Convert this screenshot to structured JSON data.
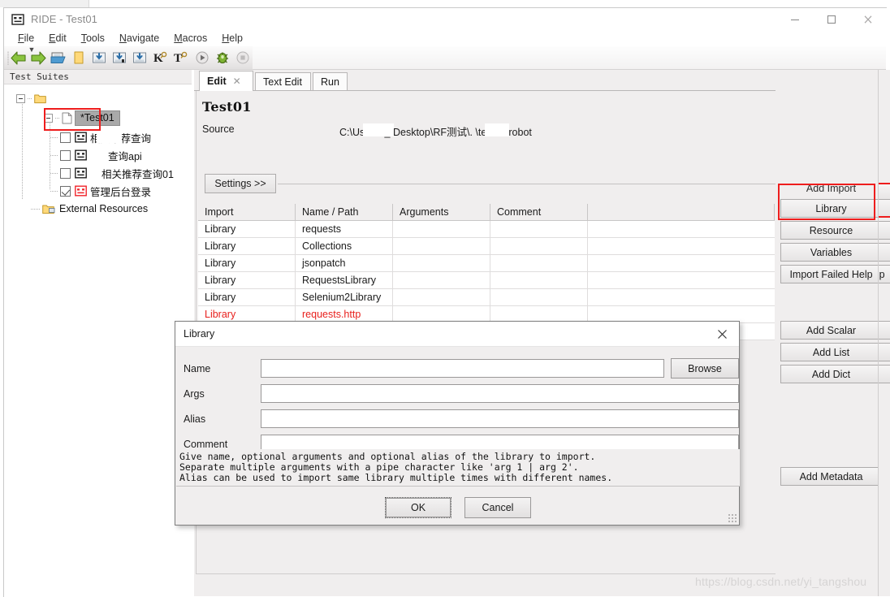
{
  "window": {
    "title": "RIDE - Test01",
    "icon": "robot-icon",
    "minimize": "—",
    "maximize": "□",
    "close": "✕"
  },
  "menubar": {
    "items": [
      {
        "label": "File",
        "accel": "F"
      },
      {
        "label": "Edit",
        "accel": "E"
      },
      {
        "label": "Tools",
        "accel": "T"
      },
      {
        "label": "Navigate",
        "accel": "N"
      },
      {
        "label": "Macros",
        "accel": "M"
      },
      {
        "label": "Help",
        "accel": "H"
      }
    ]
  },
  "toolbar": {
    "items": [
      {
        "name": "back-icon",
        "glyph": "←"
      },
      {
        "name": "forward-icon",
        "glyph": "→"
      },
      {
        "name": "open-folder-icon",
        "glyph": ""
      },
      {
        "name": "new-folder-icon",
        "glyph": ""
      },
      {
        "name": "save-icon",
        "glyph": ""
      },
      {
        "name": "save-as-icon",
        "glyph": ""
      },
      {
        "name": "save-all-icon",
        "glyph": ""
      },
      {
        "name": "search-keyword-icon",
        "glyph": "K"
      },
      {
        "name": "search-test-icon",
        "glyph": "T"
      },
      {
        "name": "run-icon",
        "glyph": "▶"
      },
      {
        "name": "debug-icon",
        "glyph": ""
      },
      {
        "name": "stop-icon",
        "glyph": "■"
      }
    ]
  },
  "sidebar": {
    "header": "Test Suites",
    "root_label": "",
    "selected_suite": "*Test01",
    "tests": [
      {
        "label": "相关推荐查询",
        "checked": false,
        "status": "normal",
        "masked": true
      },
      {
        "label": "查询api",
        "checked": false,
        "status": "normal",
        "masked": true
      },
      {
        "label": "相关推荐查询01",
        "checked": false,
        "status": "normal",
        "masked": true
      },
      {
        "label": "管理后台登录",
        "checked": true,
        "status": "error",
        "masked": false
      }
    ],
    "external_resources": "External Resources"
  },
  "editor": {
    "tabs": [
      {
        "label": "Edit",
        "active": true,
        "closable": true
      },
      {
        "label": "Text Edit",
        "active": false,
        "closable": false
      },
      {
        "label": "Run",
        "active": false,
        "closable": false
      }
    ],
    "title": "Test01",
    "source_label": "Source",
    "source_value": "C:\\Users\\        _\\Desktop\\RF测试\\.      \\test01.robot",
    "settings_button": "Settings  >>"
  },
  "import_grid": {
    "columns": [
      "Import",
      "Name / Path",
      "Arguments",
      "Comment",
      ""
    ],
    "rows": [
      {
        "cells": [
          "Library",
          "requests",
          "",
          "",
          ""
        ],
        "error": false
      },
      {
        "cells": [
          "Library",
          "Collections",
          "",
          "",
          ""
        ],
        "error": false
      },
      {
        "cells": [
          "Library",
          "jsonpatch",
          "",
          "",
          ""
        ],
        "error": false
      },
      {
        "cells": [
          "Library",
          "RequestsLibrary",
          "",
          "",
          ""
        ],
        "error": false
      },
      {
        "cells": [
          "Library",
          "Selenium2Library",
          "",
          "",
          ""
        ],
        "error": false
      },
      {
        "cells": [
          "Library",
          "requests.http",
          "",
          "",
          ""
        ],
        "error": true
      }
    ]
  },
  "button_panel": {
    "add_import_label": "Add Import",
    "import_buttons": [
      "Library",
      "Resource",
      "Variables",
      "Import Failed Help"
    ],
    "variable_buttons": [
      "Add Scalar",
      "Add List",
      "Add Dict"
    ],
    "metadata_button": "Add Metadata",
    "highlight_color": "#ee1d1d"
  },
  "dialog": {
    "title": "Library",
    "close_glyph": "✕",
    "fields": [
      {
        "label": "Name",
        "value": "",
        "placeholder": ""
      },
      {
        "label": "Args",
        "value": "",
        "placeholder": ""
      },
      {
        "label": "Alias",
        "value": "",
        "placeholder": ""
      },
      {
        "label": "Comment",
        "value": "",
        "placeholder": ""
      }
    ],
    "browse_button": "Browse",
    "help_lines": [
      "Give name, optional arguments and optional alias of the library to import.",
      "Separate multiple arguments with a pipe character like 'arg 1 | arg 2'.",
      "Alias can be used to import same library multiple times with different names."
    ],
    "ok_button": "OK",
    "cancel_button": "Cancel"
  },
  "watermark": "https://blog.csdn.net/yi_tangshou"
}
